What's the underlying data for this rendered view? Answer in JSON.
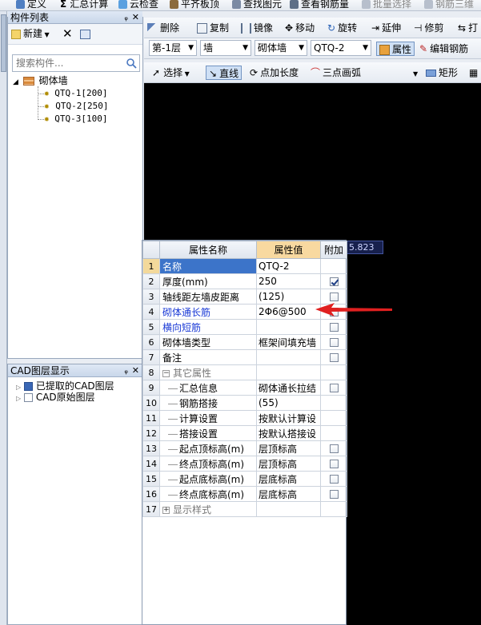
{
  "toolbar_top": {
    "items": [
      "定义",
      "汇总计算",
      "云检查",
      "平齐板顶",
      "查找图元",
      "查看钢筋量",
      "批量选择",
      "钢筋三维"
    ]
  },
  "component_panel": {
    "title": "构件列表",
    "new_label": "新建",
    "search_placeholder": "搜索构件...",
    "tree": {
      "group": "砌体墙",
      "items": [
        "QTQ-1[200]",
        "QTQ-2[250]",
        "QTQ-3[100]"
      ],
      "selected_index": 1
    }
  },
  "cad_panel": {
    "title": "CAD图层显示",
    "layers": [
      {
        "label": "已提取的CAD图层",
        "checked": false
      },
      {
        "label": "CAD原始图层",
        "checked": false
      }
    ]
  },
  "edit_toolbar": {
    "items": [
      "删除",
      "复制",
      "镜像",
      "移动",
      "旋转",
      "延伸",
      "修剪",
      "打"
    ]
  },
  "filter_toolbar": {
    "floor": "第-1层",
    "type": "墙",
    "subtype": "砌体墙",
    "component": "QTQ-2",
    "properties_label": "属性",
    "edit_rebar_label": "编辑钢筋"
  },
  "draw_toolbar": {
    "select_label": "选择",
    "line_label": "直线",
    "point_length_label": "点加长度",
    "arc_label": "三点画弧",
    "rect_label": "矩形"
  },
  "coordinate_readout": "5.823",
  "property_grid": {
    "headers": {
      "num": "",
      "name": "属性名称",
      "value": "属性值",
      "extra": "附加"
    },
    "rows": [
      {
        "num": "1",
        "name": "名称",
        "value": "QTQ-2",
        "checkbox": null,
        "style": "blue",
        "selected": true
      },
      {
        "num": "2",
        "name": "厚度(mm)",
        "value": "250",
        "checkbox": true,
        "style": "normal"
      },
      {
        "num": "3",
        "name": "轴线距左墙皮距离",
        "value": "(125)",
        "checkbox": false,
        "style": "normal"
      },
      {
        "num": "4",
        "name": "砌体通长筋",
        "value": "2Φ6@500",
        "checkbox": false,
        "style": "blue"
      },
      {
        "num": "5",
        "name": "横向短筋",
        "value": "",
        "checkbox": false,
        "style": "blue"
      },
      {
        "num": "6",
        "name": "砌体墙类型",
        "value": "框架间填充墙",
        "checkbox": false,
        "style": "normal"
      },
      {
        "num": "7",
        "name": "备注",
        "value": "",
        "checkbox": false,
        "style": "normal"
      },
      {
        "num": "8",
        "name": "其它属性",
        "value": "",
        "checkbox": null,
        "style": "group-minus"
      },
      {
        "num": "9",
        "name": "汇总信息",
        "value": "砌体通长拉结",
        "checkbox": false,
        "style": "child"
      },
      {
        "num": "10",
        "name": "钢筋搭接",
        "value": "(55)",
        "checkbox": null,
        "style": "child"
      },
      {
        "num": "11",
        "name": "计算设置",
        "value": "按默认计算设",
        "checkbox": null,
        "style": "child"
      },
      {
        "num": "12",
        "name": "搭接设置",
        "value": "按默认搭接设",
        "checkbox": null,
        "style": "child"
      },
      {
        "num": "13",
        "name": "起点顶标高(m)",
        "value": "层顶标高",
        "checkbox": false,
        "style": "child"
      },
      {
        "num": "14",
        "name": "终点顶标高(m)",
        "value": "层顶标高",
        "checkbox": false,
        "style": "child"
      },
      {
        "num": "15",
        "name": "起点底标高(m)",
        "value": "层底标高",
        "checkbox": false,
        "style": "child"
      },
      {
        "num": "16",
        "name": "终点底标高(m)",
        "value": "层底标高",
        "checkbox": false,
        "style": "child"
      },
      {
        "num": "17",
        "name": "显示样式",
        "value": "",
        "checkbox": null,
        "style": "group-plus"
      }
    ]
  },
  "colors": {
    "selection_blue": "#3469b7",
    "link_blue": "#1a3ad6",
    "value_header": "#f8d9a0",
    "arrow_red": "#e02020",
    "canvas": "#000000"
  }
}
